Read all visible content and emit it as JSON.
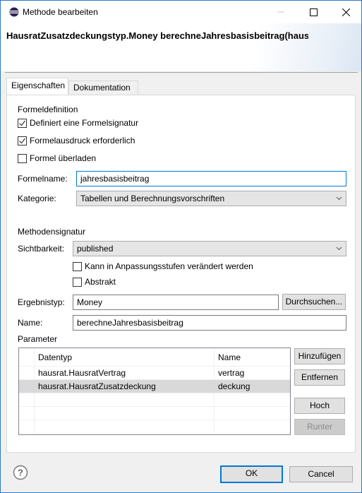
{
  "window": {
    "title": "Methode bearbeiten",
    "app_icon": "eclipse-icon",
    "controls": [
      "minimize",
      "maximize",
      "close"
    ]
  },
  "header": {
    "title": "HausratZusatzdeckungstyp.Money berechneJahresbasisbeitrag(hausra"
  },
  "tabs": [
    {
      "label": "Eigenschaften",
      "active": true
    },
    {
      "label": "Dokumentation",
      "active": false
    }
  ],
  "formula": {
    "section_label": "Formeldefinition",
    "checkboxes": [
      {
        "label": "Definiert eine Formelsignatur",
        "checked": true
      },
      {
        "label": "Formelausdruck erforderlich",
        "checked": true
      },
      {
        "label": "Formel überladen",
        "checked": false
      }
    ],
    "formelname_label": "Formelname:",
    "formelname_value": "jahresbasisbeitrag",
    "kategorie_label": "Kategorie:",
    "kategorie_value": "Tabellen und Berechnungsvorschriften"
  },
  "signature": {
    "section_label": "Methodensignatur",
    "sichtbarkeit_label": "Sichtbarkeit:",
    "sichtbarkeit_value": "published",
    "checkboxes": [
      {
        "label": "Kann in Anpassungsstufen verändert werden",
        "checked": false
      },
      {
        "label": "Abstrakt",
        "checked": false
      }
    ],
    "ergebnistyp_label": "Ergebnistyp:",
    "ergebnistyp_value": "Money",
    "browse_label": "Durchsuchen...",
    "name_label": "Name:",
    "name_value": "berechneJahresbasisbeitrag"
  },
  "parameters": {
    "section_label": "Parameter",
    "columns": [
      "Datentyp",
      "Name"
    ],
    "rows": [
      {
        "datentyp": "hausrat.HausratVertrag",
        "name": "vertrag",
        "selected": false
      },
      {
        "datentyp": "hausrat.HausratZusatzdeckung",
        "name": "deckung",
        "selected": true
      }
    ],
    "buttons": {
      "add": "Hinzufügen",
      "remove": "Entfernen",
      "up": "Hoch",
      "down": "Runter"
    }
  },
  "footer": {
    "ok": "OK",
    "cancel": "Cancel",
    "help_icon": "help-icon"
  }
}
